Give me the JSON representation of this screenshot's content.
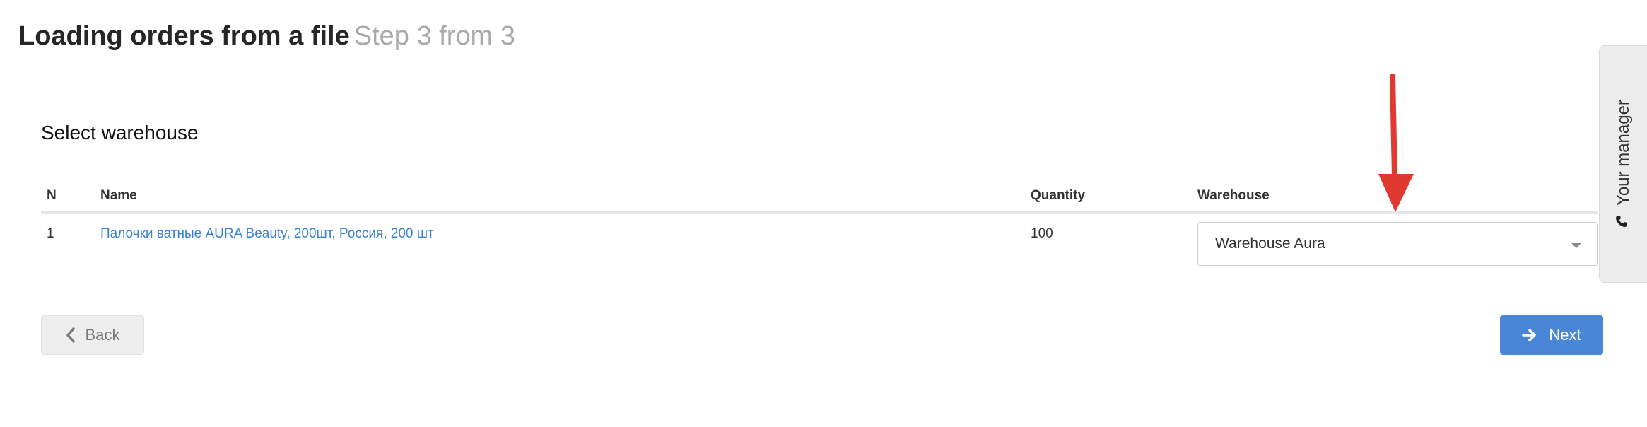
{
  "header": {
    "title": "Loading orders from a file",
    "step": "Step 3 from 3"
  },
  "section": {
    "title": "Select warehouse"
  },
  "table": {
    "columns": {
      "n": "N",
      "name": "Name",
      "quantity": "Quantity",
      "warehouse": "Warehouse"
    },
    "rows": [
      {
        "n": "1",
        "name": "Палочки ватные AURA Beauty, 200шт, Россия, 200 шт",
        "quantity": "100",
        "warehouse": "Warehouse Aura"
      }
    ]
  },
  "buttons": {
    "back": "Back",
    "next": "Next"
  },
  "sidebar": {
    "manager_label": "Your manager"
  },
  "icons": {
    "back": "chevron-left-icon",
    "next": "arrow-right-icon",
    "dropdown": "caret-down-icon",
    "phone": "phone-icon"
  },
  "colors": {
    "link": "#3a7fd4",
    "primary_button": "#4a86d8",
    "annotation_arrow": "#e03a30",
    "step_text": "#a9a9a9"
  }
}
